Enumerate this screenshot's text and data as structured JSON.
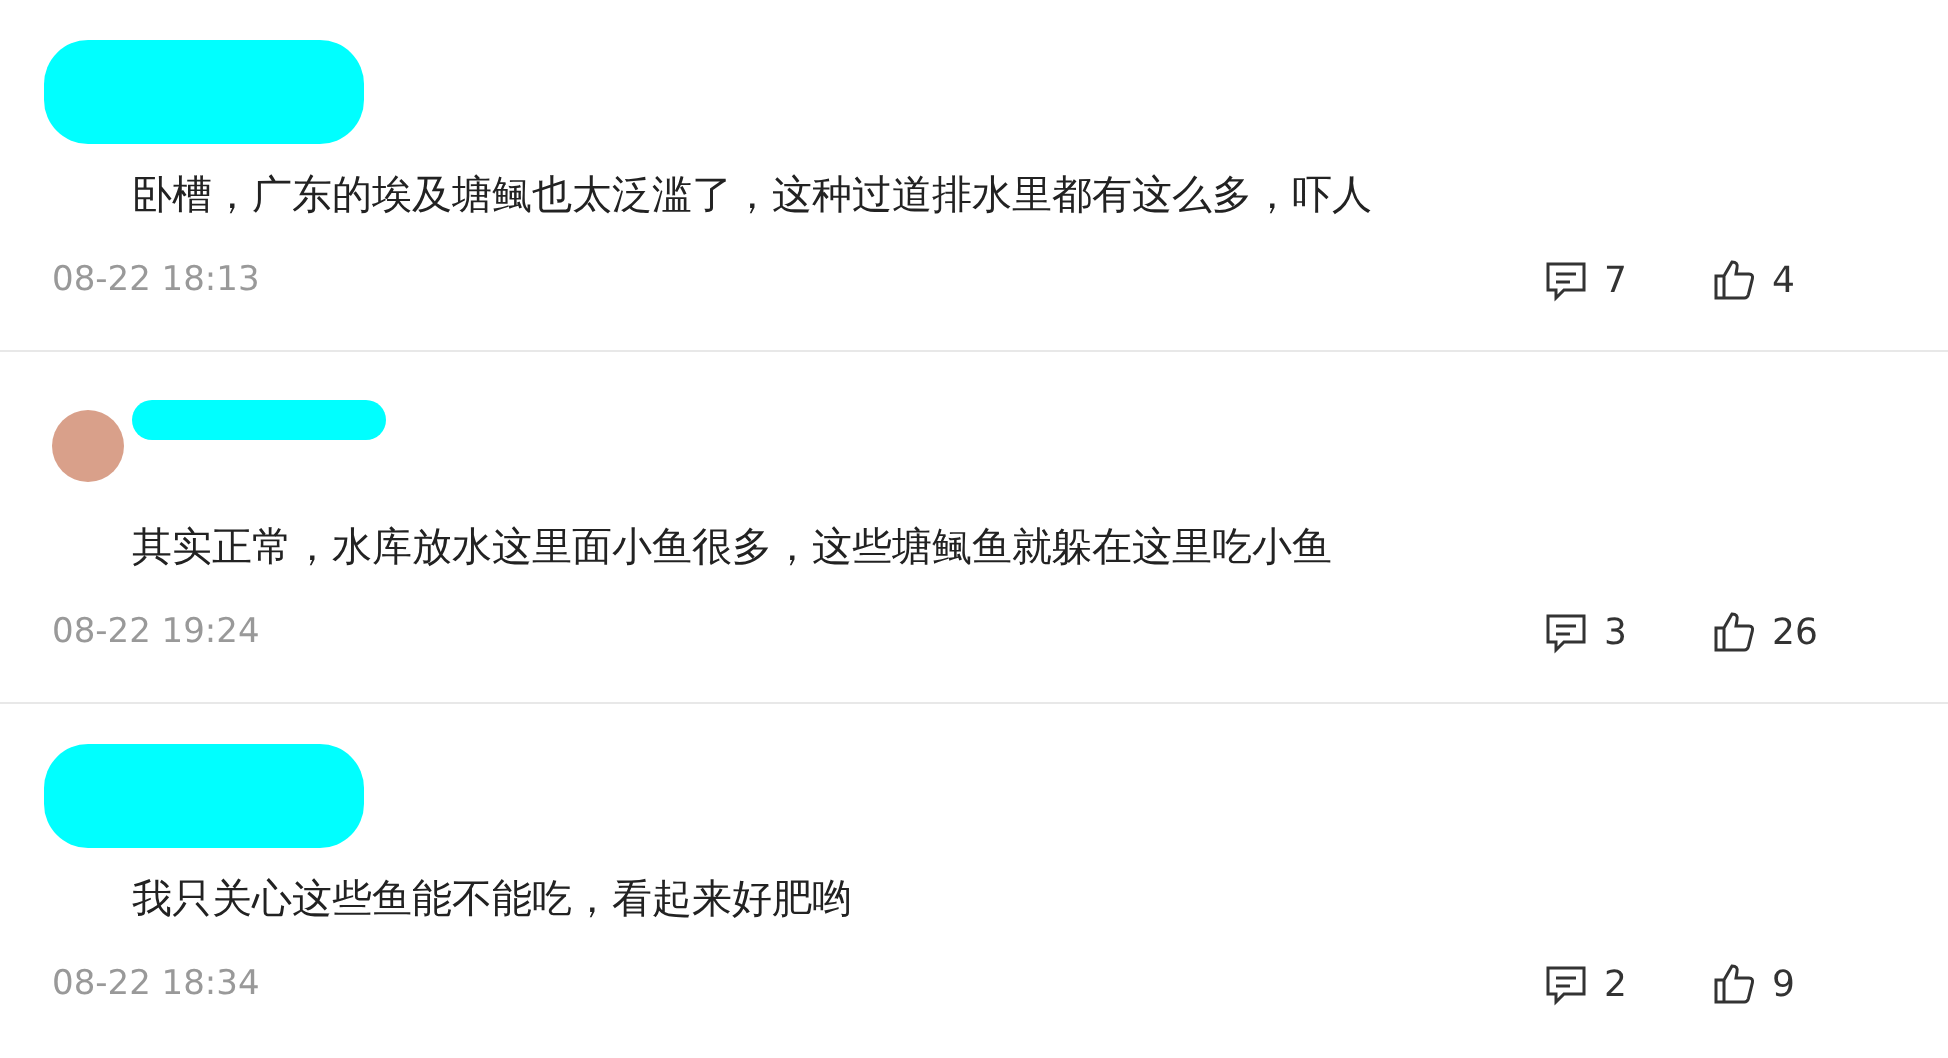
{
  "comments": [
    {
      "text": "卧槽，广东的埃及塘鲺也太泛滥了，这种过道排水里都有这么多，吓人",
      "time": "08-22 18:13",
      "replies": "7",
      "likes": "4"
    },
    {
      "text": "其实正常，水库放水这里面小鱼很多，这些塘鲺鱼就躲在这里吃小鱼",
      "time": "08-22 19:24",
      "replies": "3",
      "likes": "26"
    },
    {
      "text": "我只关心这些鱼能不能吃，看起来好肥哟",
      "time": "08-22 18:34",
      "replies": "2",
      "likes": "9"
    }
  ]
}
